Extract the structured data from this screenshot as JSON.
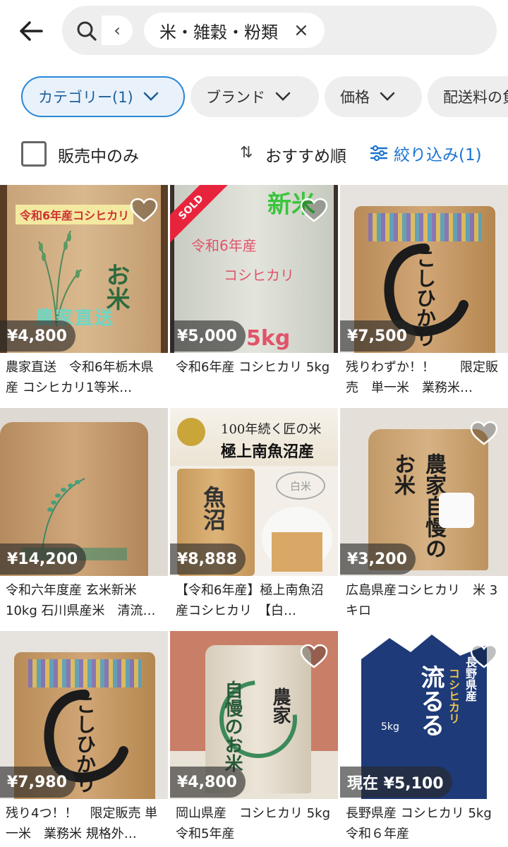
{
  "search": {
    "back_label": "←",
    "prev_label": "‹",
    "chip_label": "米・雑穀・粉類",
    "chip_close": "×"
  },
  "filters": [
    {
      "label": "カテゴリー(1)",
      "active": true
    },
    {
      "label": "ブランド",
      "active": false
    },
    {
      "label": "価格",
      "active": false
    },
    {
      "label": "配送料の負",
      "active": false
    }
  ],
  "sort_row": {
    "onsale_label": "販売中のみ",
    "sort_icon": "⇅",
    "sort_label": "おすすめ順",
    "narrow_label": "絞り込み(1)"
  },
  "items": [
    {
      "price": "¥4,800",
      "title": "農家直送　令和6年栃木県産 コシヒカリ1等米…",
      "sold": false,
      "heart": true,
      "image": {
        "bag_label": "令和6年産コシヒカリ",
        "big_text": "お米",
        "overlay": "農家直送"
      }
    },
    {
      "price": "¥5,000",
      "title": "令和6年産 コシヒカリ 5kg",
      "sold": true,
      "sold_label": "SOLD",
      "heart": true,
      "image": {
        "line1": "令和6年産",
        "line2": "コシヒカリ",
        "overlay": "新米",
        "weight": "5kg"
      }
    },
    {
      "price": "¥7,500",
      "title": "残りわずか！！　　限定販売　単一米　業務米…",
      "sold": false,
      "heart": false,
      "image": {
        "brush": "こしひかり"
      }
    },
    {
      "price": "¥14,200",
      "title": "令和六年度産 玄米新米 10kg 石川県産米　清流…",
      "sold": false,
      "heart": false,
      "image": {}
    },
    {
      "price": "¥8,888",
      "title": "【令和6年産】極上南魚沼産コシヒカリ　【白…",
      "sold": false,
      "heart": false,
      "image": {
        "banner1": "100年続く匠の米",
        "banner2": "極上南魚沼産",
        "bag": "魚沼",
        "tag": "白米"
      }
    },
    {
      "price": "¥3,200",
      "title": "広島県産コシヒカリ　米 3キロ",
      "sold": false,
      "heart": true,
      "image": {
        "brush": "農家自慢のお米"
      }
    },
    {
      "price": "¥7,980",
      "title": "残り4つ！！　限定販売 単一米　業務米 規格外…",
      "sold": false,
      "heart": false,
      "image": {
        "brush": "こしひかり"
      }
    },
    {
      "price": "¥4,800",
      "title": "岡山県産　コシヒカリ 5kg 令和5年産",
      "sold": false,
      "heart": true,
      "image": {
        "brush1": "自慢のお米",
        "brush2": "農家"
      }
    },
    {
      "price": "現在 ¥5,100",
      "title": "長野県産 コシヒカリ 5kg 令和６年産",
      "sold": false,
      "heart": true,
      "image": {
        "pref": "長野県産",
        "brand": "コシヒカリ",
        "name": "流るる",
        "weight": "5kg"
      }
    }
  ]
}
